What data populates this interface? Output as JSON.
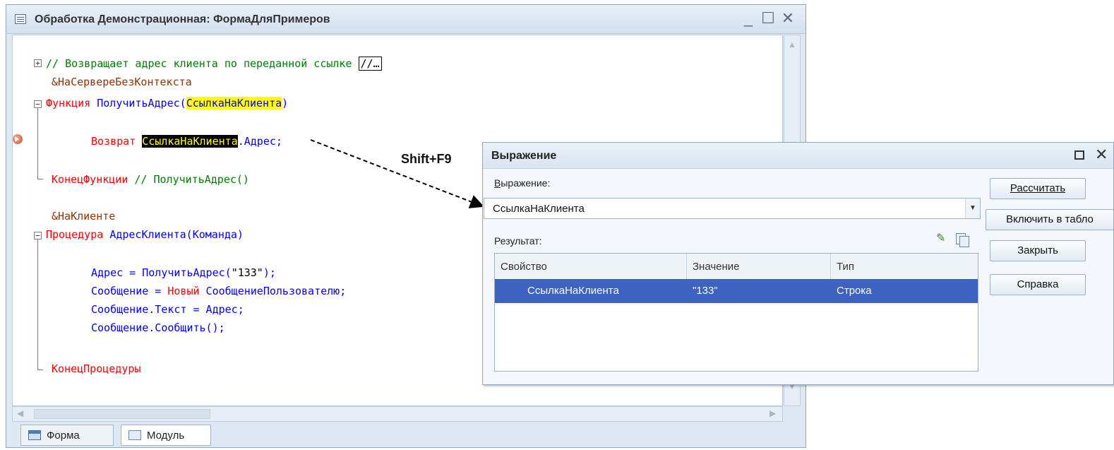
{
  "window": {
    "title": "Обработка Демонстрационная: ФормаДляПримеров",
    "minimize_glyph": "_",
    "maximize_glyph": "☐",
    "close_glyph": "✕"
  },
  "code": {
    "line1_comment": "// Возвращает адрес клиента по переданной ссылке",
    "line1_collapsed": "//…",
    "line2_directive": "&НаСервереБезКонтекста",
    "line3_kw": "Функция",
    "line3_name": "ПолучитьАдрес",
    "line3_open": "(",
    "line3_param": "СсылкаНаКлиента",
    "line3_close": ")",
    "line4_kw": "Возврат",
    "line4_var": "СсылкаНаКлиента",
    "line4_rest": ".Адрес;",
    "line5_kw": "КонецФункции",
    "line5_comment": "// ПолучитьАдрес()",
    "line6_directive": "&НаКлиенте",
    "line7_kw": "Процедура",
    "line7_name": "АдресКлиента(Команда)",
    "line8_a": "Адрес = ПолучитьАдрес(",
    "line8_str": "\"133\"",
    "line8_b": ");",
    "line9_a": "Сообщение = ",
    "line9_kw": "Новый",
    "line9_b": " СообщениеПользователю;",
    "line10": "Сообщение.Текст = Адрес;",
    "line11": "Сообщение.Сообщить();",
    "line12_kw": "КонецПроцедуры"
  },
  "tabs": [
    {
      "label": "Форма"
    },
    {
      "label": "Модуль"
    }
  ],
  "shortcut_label": "Shift+F9",
  "dialog": {
    "title": "Выражение",
    "expression_label": "Выражение:",
    "expression_value": "СсылкаНаКлиента",
    "result_label": "Результат:",
    "columns": [
      "Свойство",
      "Значение",
      "Тип"
    ],
    "rows": [
      {
        "property": "СсылкаНаКлиента",
        "value": "\"133\"",
        "type": "Строка"
      }
    ],
    "buttons": {
      "calculate": "Рассчитать",
      "add_to_board": "Включить в табло",
      "close": "Закрыть",
      "help": "Справка"
    }
  },
  "colors": {
    "keyword": "#ff0000",
    "identifier": "#0000ff",
    "comment": "#008000",
    "directive": "#963200",
    "selection": "#3d62c2"
  }
}
